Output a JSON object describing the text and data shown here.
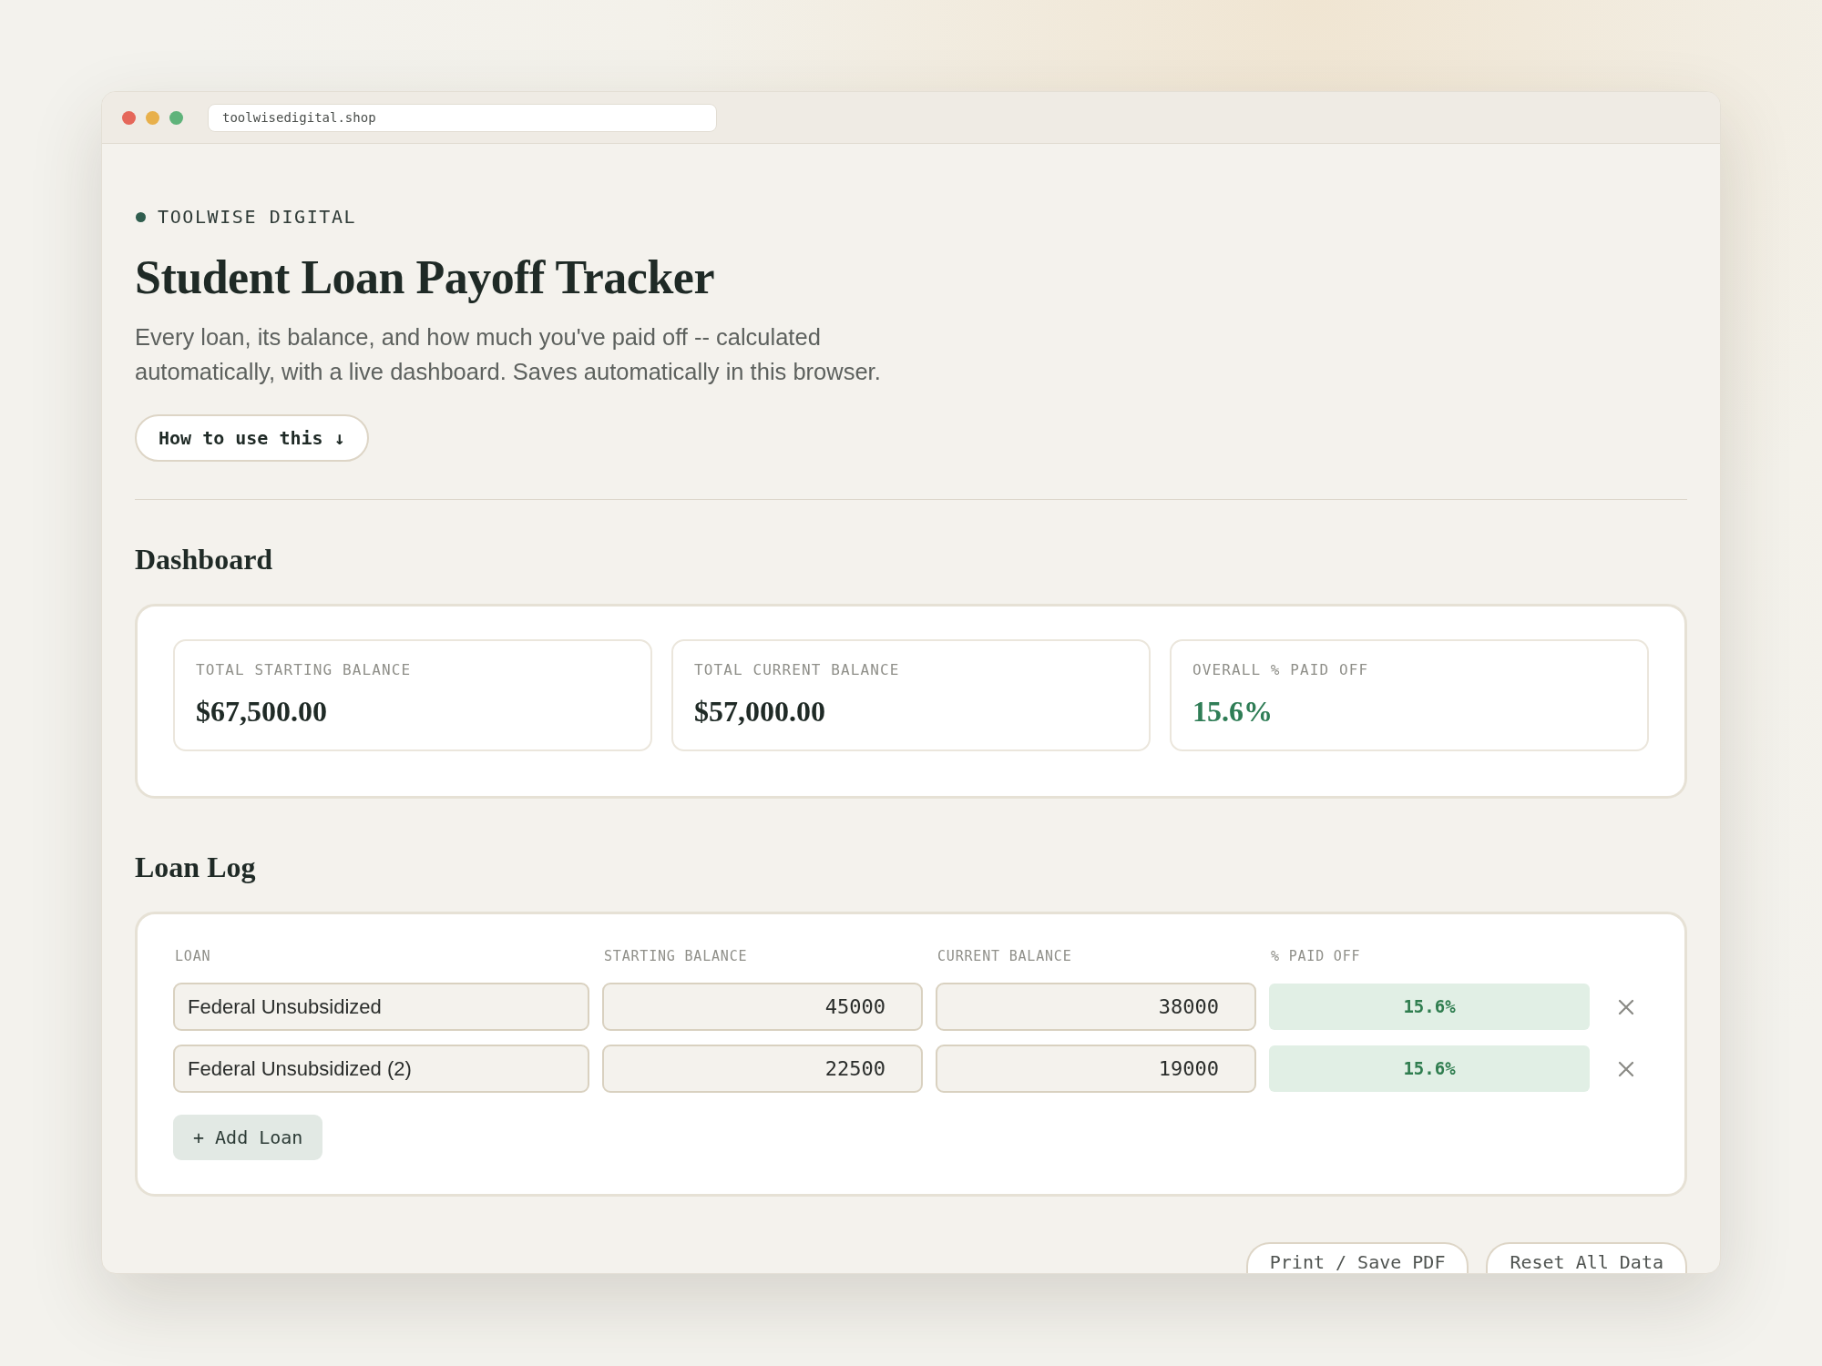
{
  "browser": {
    "url": "toolwisedigital.shop"
  },
  "brand": {
    "name": "TOOLWISE DIGITAL"
  },
  "header": {
    "title": "Student Loan Payoff Tracker",
    "description": "Every loan, its balance, and how much you've paid off -- calculated automatically, with a live dashboard. Saves automatically in this browser.",
    "help_button": "How to use this ↓"
  },
  "dashboard": {
    "heading": "Dashboard",
    "stats": [
      {
        "label": "TOTAL STARTING BALANCE",
        "value": "$67,500.00",
        "kind": "currency"
      },
      {
        "label": "TOTAL CURRENT BALANCE",
        "value": "$57,000.00",
        "kind": "currency"
      },
      {
        "label": "OVERALL % PAID OFF",
        "value": "15.6%",
        "kind": "percent"
      }
    ]
  },
  "loan_log": {
    "heading": "Loan Log",
    "columns": [
      "LOAN",
      "STARTING BALANCE",
      "CURRENT BALANCE",
      "% PAID OFF"
    ],
    "rows": [
      {
        "name": "Federal Unsubsidized",
        "starting_balance": "45000",
        "current_balance": "38000",
        "paid_off": "15.6%"
      },
      {
        "name": "Federal Unsubsidized (2)",
        "starting_balance": "22500",
        "current_balance": "19000",
        "paid_off": "15.6%"
      }
    ],
    "add_button": "+ Add Loan"
  },
  "actions": [
    "Print / Save PDF",
    "Reset All Data"
  ]
}
